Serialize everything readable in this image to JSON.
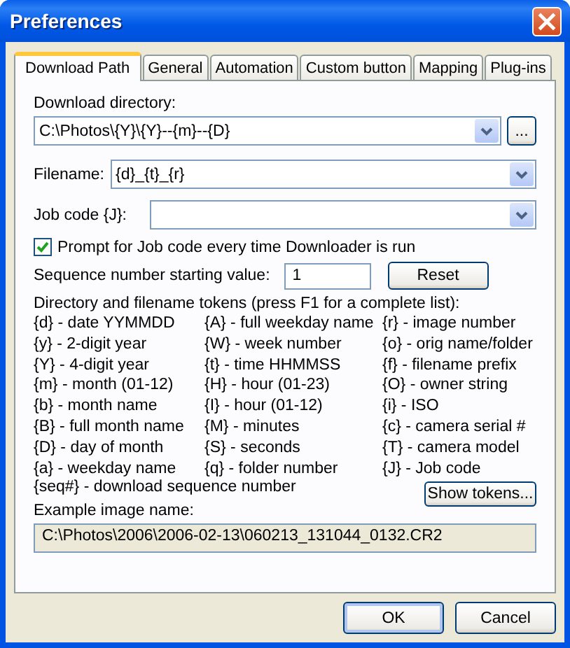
{
  "window": {
    "title": "Preferences"
  },
  "tabs": [
    {
      "label": "Download Path",
      "selected": true
    },
    {
      "label": "General",
      "selected": false
    },
    {
      "label": "Automation",
      "selected": false
    },
    {
      "label": "Custom button",
      "selected": false
    },
    {
      "label": "Mapping",
      "selected": false
    },
    {
      "label": "Plug-ins",
      "selected": false
    }
  ],
  "download_directory": {
    "label": "Download directory:",
    "value": "C:\\Photos\\{Y}\\{Y}--{m}--{D}",
    "browse_button": "..."
  },
  "filename": {
    "label": "Filename:",
    "value": "{d}_{t}_{r}"
  },
  "job_code": {
    "label": "Job code {J}:"
  },
  "prompt_checkbox": {
    "label": "Prompt for Job code every time Downloader is run",
    "checked": true
  },
  "sequence": {
    "label": "Sequence number starting value:",
    "value": "1",
    "reset_button": "Reset"
  },
  "tokens_heading": "Directory and filename tokens (press F1 for a complete list):",
  "token_columns": [
    [
      "{d} - date YYMMDD",
      "{y} - 2-digit year",
      "{Y} - 4-digit year",
      "{m} - month (01-12)",
      "{b} - month name",
      "{B} - full month name",
      "{D} - day of month",
      "{a} - weekday name"
    ],
    [
      "{A} - full weekday name",
      "{W} - week number",
      "{t} - time HHMMSS",
      "{H} - hour (01-23)",
      "{I} - hour (01-12)",
      "{M} - minutes",
      "{S} - seconds",
      "{q} - folder number"
    ],
    [
      "{r} - image number",
      "{o} - orig name/folder",
      "{f} - filename prefix",
      "{O} - owner string",
      "{i} - ISO",
      "{c} - camera serial #",
      "{T} - camera model",
      "{J} - Job code"
    ]
  ],
  "seq_token": "{seq#} - download sequence number",
  "show_tokens_button": "Show tokens...",
  "example": {
    "label": "Example image name:",
    "value": "C:\\Photos\\2006\\2006-02-13\\060213_131044_0132.CR2"
  },
  "buttons": [
    "OK",
    "Cancel"
  ]
}
